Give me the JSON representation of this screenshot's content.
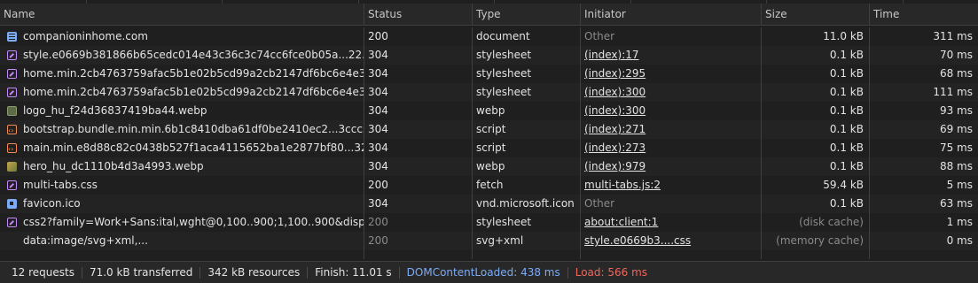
{
  "columns": [
    "Name",
    "Status",
    "Type",
    "Initiator",
    "Size",
    "Time"
  ],
  "rows": [
    {
      "icon": "document-icon",
      "name": "companioninhome.com",
      "status": "200",
      "type": "document",
      "initiator": "Other",
      "initiator_link": false,
      "size": "11.0 kB",
      "time": "311 ms",
      "dim": false
    },
    {
      "icon": "stylesheet-icon",
      "name": "style.e0669b381866b65cedc014e43c36c3c74cc6fce0b05a...22...",
      "status": "304",
      "type": "stylesheet",
      "initiator": "(index):17",
      "initiator_link": true,
      "size": "0.1 kB",
      "time": "70 ms",
      "dim": false
    },
    {
      "icon": "stylesheet-icon",
      "name": "home.min.2cb4763759afac5b1e02b5cd99a2cb2147df6bc6e4e3...",
      "status": "304",
      "type": "stylesheet",
      "initiator": "(index):295",
      "initiator_link": true,
      "size": "0.1 kB",
      "time": "68 ms",
      "dim": false
    },
    {
      "icon": "stylesheet-icon",
      "name": "home.min.2cb4763759afac5b1e02b5cd99a2cb2147df6bc6e4e3...",
      "status": "304",
      "type": "stylesheet",
      "initiator": "(index):300",
      "initiator_link": true,
      "size": "0.1 kB",
      "time": "111 ms",
      "dim": false
    },
    {
      "icon": "image-icon",
      "name": "logo_hu_f24d36837419ba44.webp",
      "status": "304",
      "type": "webp",
      "initiator": "(index):300",
      "initiator_link": true,
      "size": "0.1 kB",
      "time": "93 ms",
      "dim": false
    },
    {
      "icon": "script-icon",
      "name": "bootstrap.bundle.min.min.6b1c8410dba61df0be2410ec2...3ccc55...",
      "status": "304",
      "type": "script",
      "initiator": "(index):271",
      "initiator_link": true,
      "size": "0.1 kB",
      "time": "69 ms",
      "dim": false
    },
    {
      "icon": "script-icon",
      "name": "main.min.e8d88c82c0438b527f1aca4115652ba1e2877bf80...32b...",
      "status": "304",
      "type": "script",
      "initiator": "(index):273",
      "initiator_link": true,
      "size": "0.1 kB",
      "time": "75 ms",
      "dim": false
    },
    {
      "icon": "photo-icon",
      "name": "hero_hu_dc1110b4d3a4993.webp",
      "status": "304",
      "type": "webp",
      "initiator": "(index):979",
      "initiator_link": true,
      "size": "0.1 kB",
      "time": "88 ms",
      "dim": false
    },
    {
      "icon": "stylesheet-icon",
      "name": "multi-tabs.css",
      "status": "200",
      "type": "fetch",
      "initiator": "multi-tabs.js:2",
      "initiator_link": true,
      "size": "59.4 kB",
      "time": "5 ms",
      "dim": false
    },
    {
      "icon": "favicon-icon",
      "name": "favicon.ico",
      "status": "304",
      "type": "vnd.microsoft.icon",
      "initiator": "Other",
      "initiator_link": false,
      "size": "0.1 kB",
      "time": "63 ms",
      "dim": false
    },
    {
      "icon": "stylesheet-icon",
      "name": "css2?family=Work+Sans:ital,wght@0,100..900;1,100..900&display...",
      "status": "200",
      "type": "stylesheet",
      "initiator": "about:client:1",
      "initiator_link": true,
      "size": "(disk cache)",
      "time": "1 ms",
      "dim": true
    },
    {
      "icon": "blank-icon",
      "name": "data:image/svg+xml,...",
      "status": "200",
      "type": "svg+xml",
      "initiator": "style.e0669b3....css",
      "initiator_link": true,
      "size": "(memory cache)",
      "time": "0 ms",
      "dim": true
    }
  ],
  "status_bar": {
    "requests": "12 requests",
    "transferred": "71.0 kB transferred",
    "resources": "342 kB resources",
    "finish": "Finish: 11.01 s",
    "dom_content_loaded": "DOMContentLoaded: 438 ms",
    "load": "Load: 566 ms"
  },
  "colors": {
    "dom_content_loaded": "#7cacf8",
    "load": "#ee675c"
  }
}
